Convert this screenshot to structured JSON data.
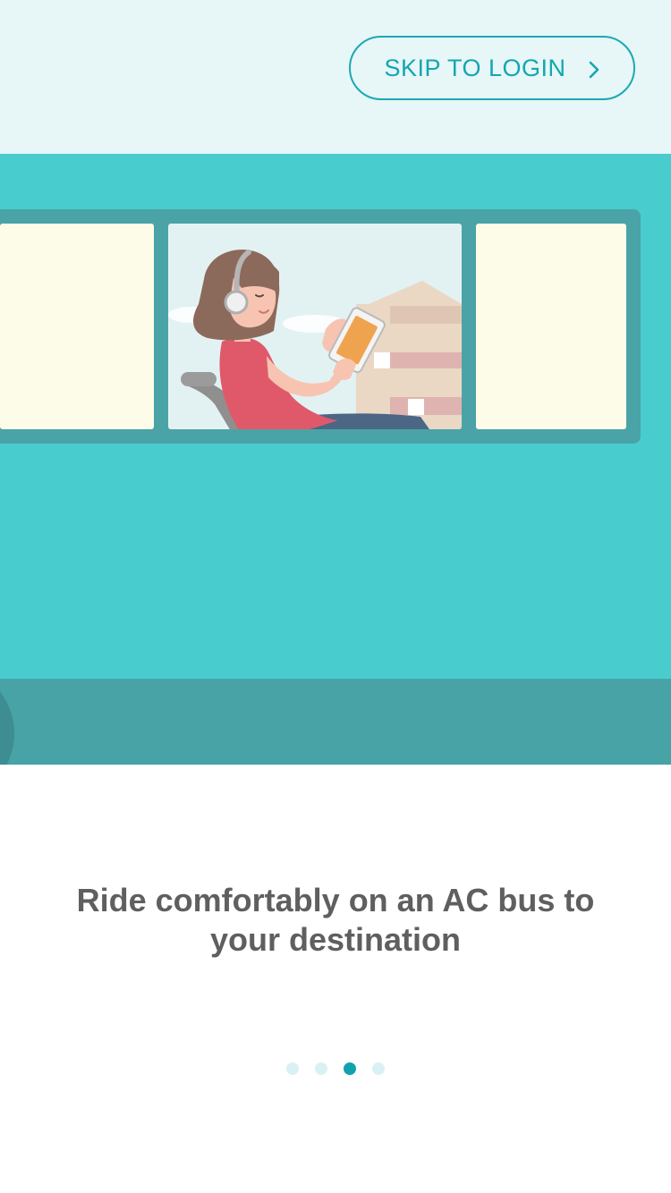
{
  "header": {
    "skip_label": "SKIP TO LOGIN",
    "skip_icon": "chevron-right-icon"
  },
  "illustration": {
    "subject": "bus-window-woman-with-phone",
    "colors": {
      "bus_body": "#49cccd",
      "bus_skirt": "#48a3a6",
      "window_frame": "#4aa3a6",
      "window_glass_blank": "#fcfce9",
      "sky": "#e2f2f3",
      "shirt": "#e0596b",
      "hair": "#8c6a5b",
      "phone_screen": "#f0a34e"
    }
  },
  "onboarding": {
    "caption": "Ride comfortably on an AC bus to your destination"
  },
  "pager": {
    "total": 4,
    "active_index": 2,
    "active_color": "#12a2ad",
    "inactive_color": "#d9f1f4"
  }
}
